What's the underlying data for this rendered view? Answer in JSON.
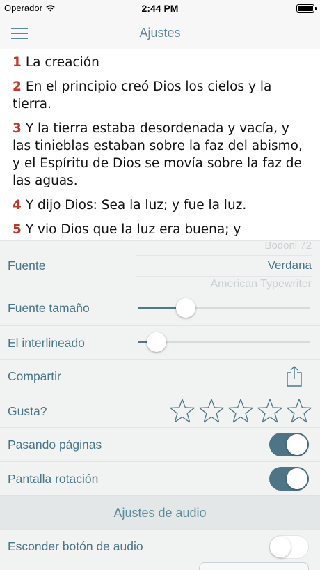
{
  "status_bar": {
    "carrier": "Operador",
    "time": "2:44 PM"
  },
  "nav": {
    "title": "Ajustes"
  },
  "reading": {
    "verses": [
      {
        "num": "1",
        "text": "La creación"
      },
      {
        "num": "2",
        "text": "En el principio creó Dios los cielos y la tierra."
      },
      {
        "num": "3",
        "text": "Y la tierra estaba desordenada y vacía, y las tinieblas estaban sobre la faz del abismo, y el Espíritu de Dios se movía sobre la faz de las aguas."
      },
      {
        "num": "4",
        "text": "Y dijo Dios: Sea la luz; y fue la luz."
      },
      {
        "num": "5",
        "text": "Y vio Dios que la luz era buena; y"
      }
    ]
  },
  "settings": {
    "font": {
      "label": "Fuente",
      "options_above": "Bodoni 72",
      "selected": "Verdana",
      "options_below": "American Typewriter"
    },
    "font_size": {
      "label": "Fuente tamaño",
      "value_fraction": 0.25
    },
    "line_spacing": {
      "label": "El interlineado",
      "value_fraction": 0.06
    },
    "share": {
      "label": "Compartir"
    },
    "rating": {
      "label": "Gusta?",
      "stars_total": 5,
      "stars_filled": 0
    },
    "page_turning": {
      "label": "Pasando páginas",
      "on": true
    },
    "screen_rotation": {
      "label": "Pantalla rotación",
      "on": true
    },
    "audio_section": {
      "title": "Ajustes de audio"
    },
    "hide_audio_button": {
      "label": "Esconder botón de audio",
      "on": false
    }
  },
  "colors": {
    "accent": "#4e7586",
    "label_text": "#4a7585",
    "verse_number": "#c0392b",
    "background": "#f1f3f3"
  },
  "icons": {
    "menu": "hamburger-menu-icon",
    "share": "share-icon",
    "star": "star-outline-icon",
    "wifi": "wifi-icon",
    "battery": "battery-icon"
  }
}
